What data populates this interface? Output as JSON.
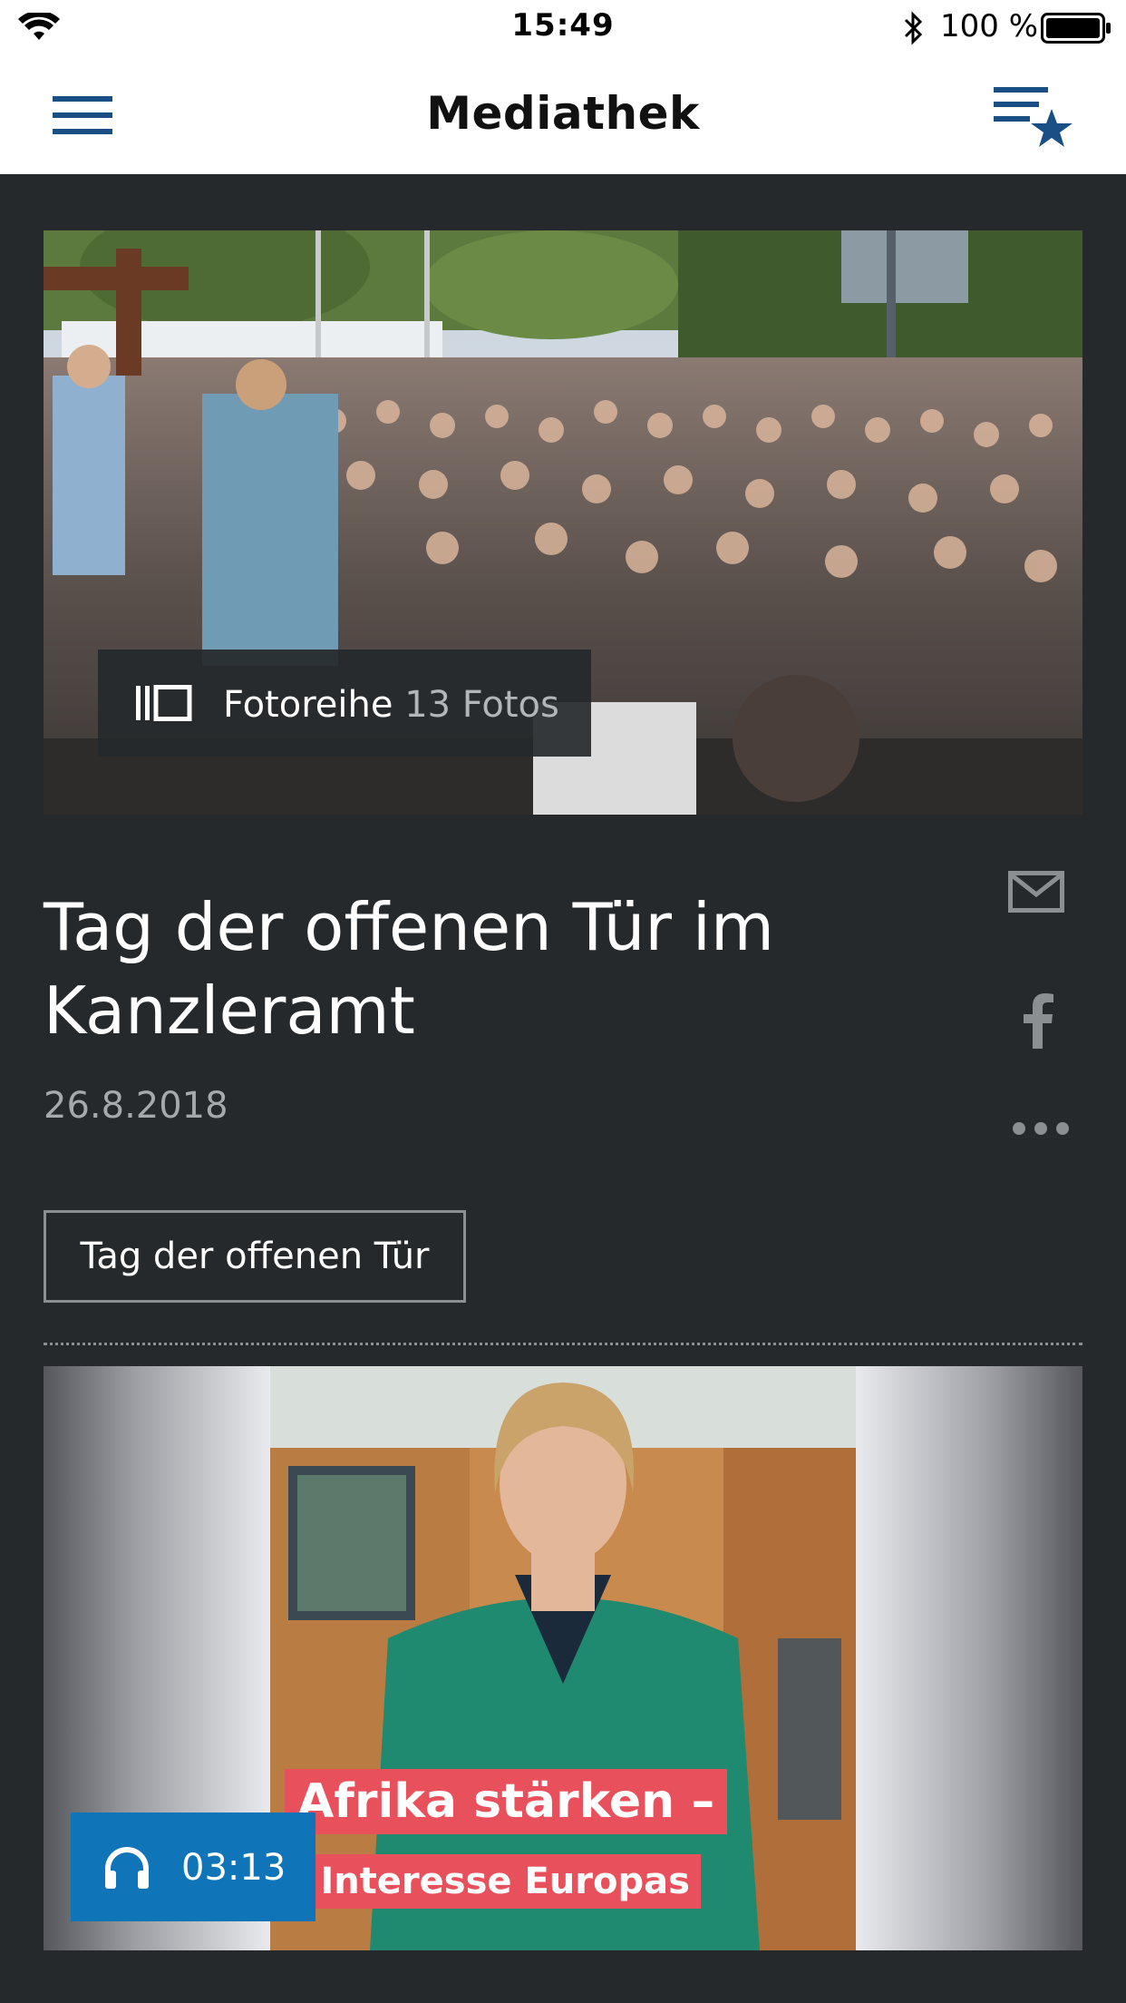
{
  "status_bar": {
    "time": "15:49",
    "battery": "100 %"
  },
  "nav": {
    "title": "Mediathek",
    "menu_icon": "hamburger-menu-icon",
    "favorites_icon": "favorites-list-icon"
  },
  "hero": {
    "badge_label": "Fotoreihe",
    "badge_count": "13 Fotos",
    "badge_icon": "gallery-icon"
  },
  "article": {
    "title": "Tag der offenen Tür im Kanzleramt",
    "date": "26.8.2018",
    "tag": "Tag der offenen Tür",
    "share_icons": [
      "mail-icon",
      "facebook-icon",
      "more-icon"
    ]
  },
  "video": {
    "caption_line1": "Afrika stärken –",
    "caption_line2": "im Interesse Europas",
    "duration": "03:13",
    "media_icon": "headphones-icon"
  },
  "colors": {
    "background": "#25292b",
    "accent_blue": "#0f74b8",
    "caption_red": "#e8505b",
    "nav_icon_blue": "#1a4f86"
  }
}
